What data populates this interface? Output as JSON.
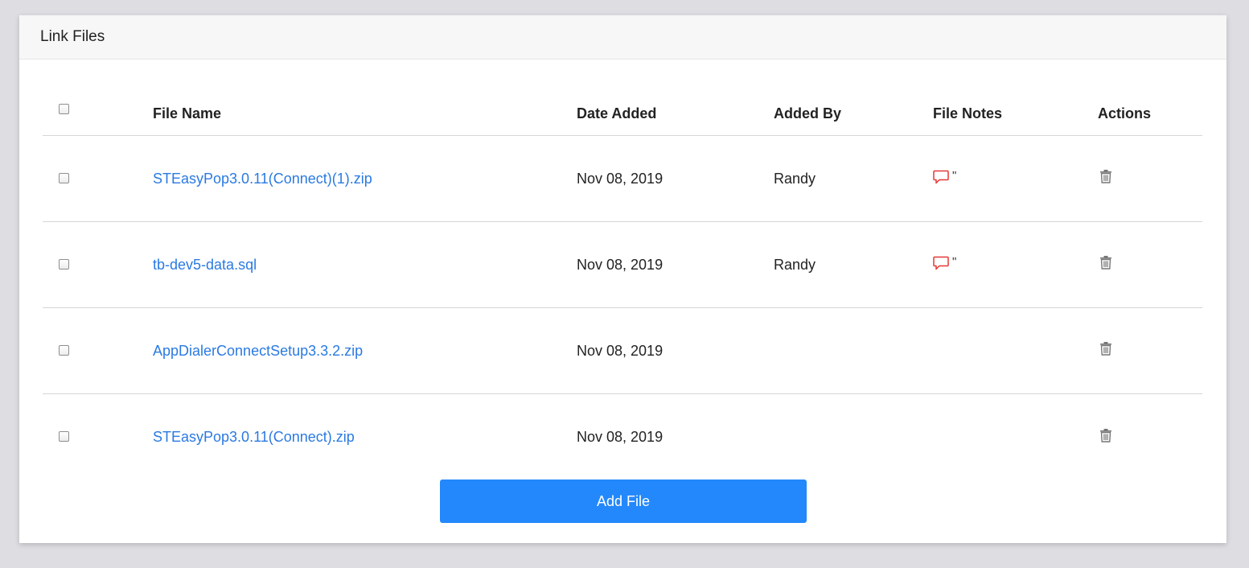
{
  "panel": {
    "title": "Link Files"
  },
  "table": {
    "headers": {
      "file_name": "File Name",
      "date_added": "Date Added",
      "added_by": "Added By",
      "file_notes": "File Notes",
      "actions": "Actions"
    },
    "rows": [
      {
        "file_name": "STEasyPop3.0.11(Connect)(1).zip",
        "date_added": "Nov 08, 2019",
        "added_by": "Randy",
        "notes_icon": "comment-icon",
        "notes_suffix": "\"",
        "action_icon": "trash-icon"
      },
      {
        "file_name": "tb-dev5-data.sql",
        "date_added": "Nov 08, 2019",
        "added_by": "Randy",
        "notes_icon": "comment-icon",
        "notes_suffix": "\"",
        "action_icon": "trash-icon"
      },
      {
        "file_name": "AppDialerConnectSetup3.3.2.zip",
        "date_added": "Nov 08, 2019",
        "added_by": "",
        "action_icon": "trash-icon"
      },
      {
        "file_name": "STEasyPop3.0.11(Connect).zip",
        "date_added": "Nov 08, 2019",
        "added_by": "",
        "action_icon": "trash-icon"
      }
    ]
  },
  "add_button": {
    "label": "Add File"
  },
  "colors": {
    "link": "#2a7ae2",
    "button": "#2388fb",
    "notes_icon": "#e53935",
    "trash_icon": "#777777"
  }
}
